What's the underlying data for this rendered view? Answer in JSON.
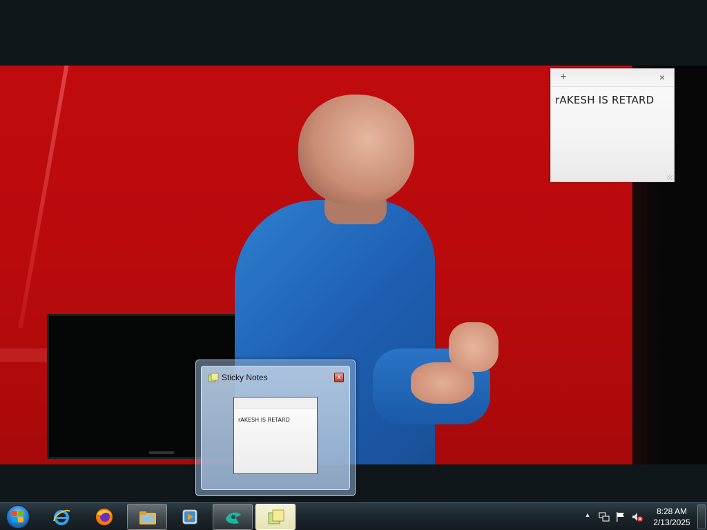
{
  "sticky_note": {
    "add_label": "+",
    "close_label": "×",
    "text": "rAKESH IS RETARD"
  },
  "taskbar_preview": {
    "title": "Sticky Notes",
    "close_label": "x",
    "thumbnail_text": "rAKESH IS RETARD"
  },
  "taskbar": {
    "pinned": [
      {
        "name": "internet-explorer",
        "icon": "internet-explorer-icon"
      },
      {
        "name": "firefox",
        "icon": "firefox-icon"
      },
      {
        "name": "windows-explorer",
        "icon": "folder-icon"
      },
      {
        "name": "media-player",
        "icon": "media-player-icon"
      },
      {
        "name": "app-teal",
        "icon": "teal-app-icon"
      },
      {
        "name": "sticky-notes",
        "icon": "sticky-notes-icon"
      }
    ],
    "tray_up": "▲",
    "clock": {
      "time": "8:28 AM",
      "date": "2/13/2025"
    }
  }
}
